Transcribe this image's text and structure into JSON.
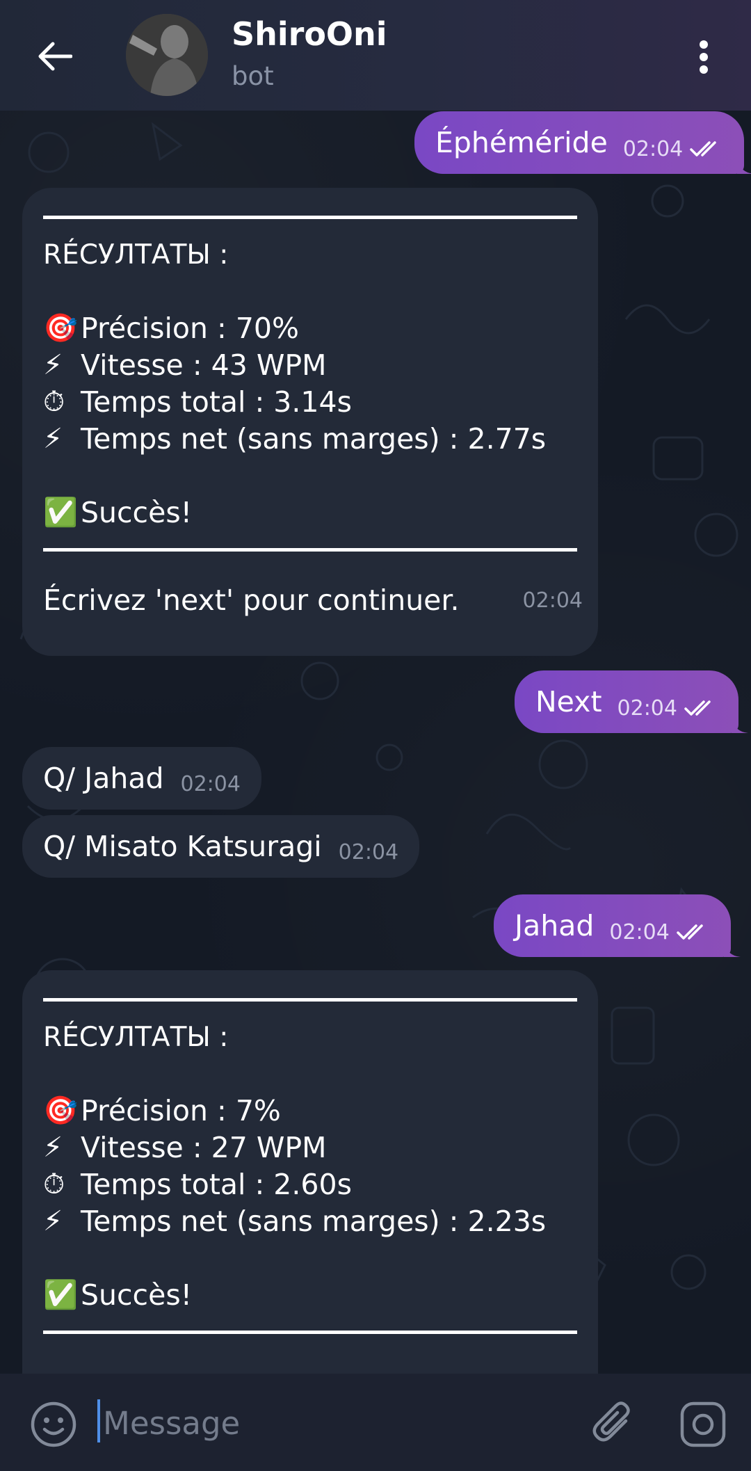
{
  "header": {
    "title": "ShiroOni",
    "subtitle": "bot"
  },
  "messages": {
    "m1": {
      "text": "Éphéméride",
      "time": "02:04"
    },
    "r1": {
      "title": "RÉCУЛТАТЫ :",
      "precision": "Précision : 70%",
      "speed": "Vitesse : 43 WPM",
      "total": "Temps total : 3.14s",
      "net": "Temps net (sans marges) : 2.77s",
      "success": "Succès!",
      "footer": "Écrivez 'next' pour continuer.",
      "time": "02:04"
    },
    "m2": {
      "text": "Next",
      "time": "02:04"
    },
    "q1": {
      "text": "Q/ Jahad",
      "time": "02:04"
    },
    "q2": {
      "text": "Q/ Misato Katsuragi",
      "time": "02:04"
    },
    "m3": {
      "text": "Jahad",
      "time": "02:04"
    },
    "r2": {
      "title": "RÉCУЛТАТЫ :",
      "precision": "Précision : 7%",
      "speed": "Vitesse : 27 WPM",
      "total": "Temps total : 2.60s",
      "net": "Temps net (sans marges) : 2.23s",
      "success": "Succès!"
    }
  },
  "emoji": {
    "target": "🎯",
    "bolt": "⚡",
    "stopwatch": "⏱",
    "check": "✅"
  },
  "input": {
    "placeholder": "Message"
  },
  "icons": {
    "back": "arrow-left",
    "menu": "vertical-dots",
    "emoji": "smiley",
    "attach": "paperclip",
    "camera": "instagram-camera",
    "read": "double-check"
  },
  "colors": {
    "outgoing_bubble": "#7a48c4",
    "incoming_bubble": "#232a38",
    "background": "#141a25",
    "header": "#232a3b"
  }
}
